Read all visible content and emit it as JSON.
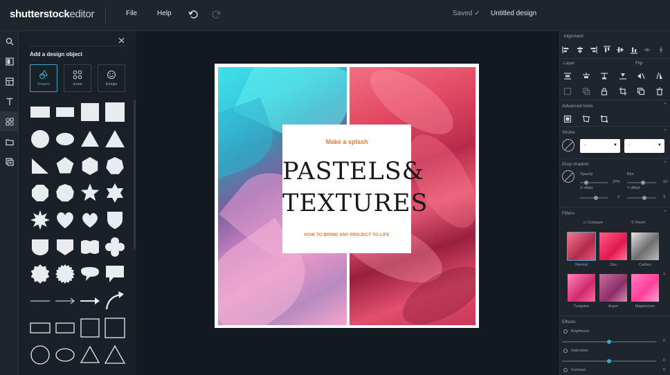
{
  "app": {
    "logo_brand": "shutterstock",
    "logo_product": "editor",
    "menu": {
      "file": "File",
      "help": "Help"
    },
    "status": "Saved",
    "title": "Untitled design"
  },
  "left_rail": {
    "icons": [
      "search-icon",
      "templates-icon",
      "layouts-icon",
      "text-icon",
      "elements-icon",
      "folder-icon",
      "add-image-icon"
    ]
  },
  "objects_panel": {
    "title": "Add a design object",
    "categories": [
      {
        "label": "Shapes",
        "active": true
      },
      {
        "label": "Icons",
        "active": false
      },
      {
        "label": "Emojis",
        "active": false
      }
    ]
  },
  "design": {
    "kicker": "Make a splash",
    "headline_line1": "PASTELS&",
    "headline_line2": "TEXTURES",
    "tagline": "HOW TO BRING ANY PROJECT TO LIFE",
    "accent_color": "#e57b3d"
  },
  "properties": {
    "alignment": "Alignment",
    "layer": "Layer",
    "flip": "Flip",
    "advanced_tools": "Advanced tools",
    "stroke": "Stroke",
    "stroke_select_1": "-",
    "stroke_select_2": "-",
    "drop_shadow": "Drop shadow",
    "opacity": "Opacity",
    "opacity_value": "20%",
    "blur": "Blur",
    "blur_value": "10",
    "x_offset": "X offset",
    "x_offset_value": "3",
    "y_offset": "Y offset",
    "y_offset_value": "3",
    "filters": "Filters",
    "compare": "Compare",
    "reset": "Reset",
    "filter_items": [
      "Normal",
      "Zeu",
      "Carbon",
      "Tungsten",
      "Argon",
      "Magnesium"
    ],
    "effects": "Effects",
    "brightness": "Brightness",
    "brightness_value": "0",
    "saturation": "Saturation",
    "saturation_value": "0",
    "contrast": "Contrast",
    "contrast_value": "0"
  }
}
